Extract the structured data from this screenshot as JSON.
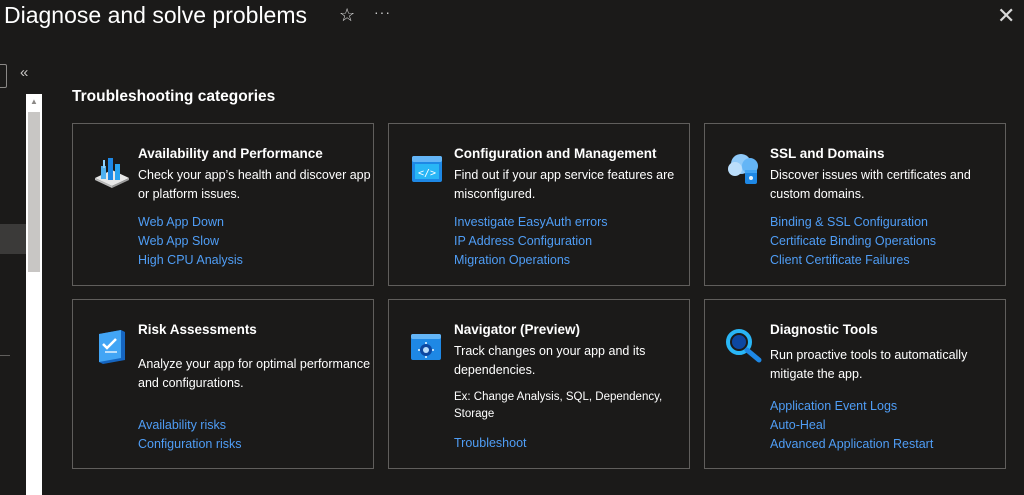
{
  "header": {
    "title": "Diagnose and solve problems",
    "favorite_icon": "☆",
    "more_icon": "···",
    "close_icon": "✕"
  },
  "sidebar": {
    "collapse_icon": "«"
  },
  "section": {
    "title": "Troubleshooting categories"
  },
  "cards": [
    {
      "icon": "availability-performance-icon",
      "title": "Availability and Performance",
      "description": "Check your app’s health and discover app or platform issues.",
      "links": [
        "Web App Down",
        "Web App Slow",
        "High CPU Analysis"
      ]
    },
    {
      "icon": "configuration-management-icon",
      "title": "Configuration and Management",
      "description": "Find out if your app service features are misconfigured.",
      "links": [
        "Investigate EasyAuth errors",
        "IP Address Configuration",
        "Migration Operations"
      ]
    },
    {
      "icon": "ssl-domains-icon",
      "title": "SSL and Domains",
      "description": "Discover issues with certificates and custom domains.",
      "links": [
        "Binding & SSL Configuration",
        "Certificate Binding Operations",
        "Client Certificate Failures"
      ]
    },
    {
      "icon": "risk-assessments-icon",
      "title": "Risk Assessments",
      "description": "Analyze your app for optimal performance and configurations.",
      "links": [
        "Availability risks",
        "Configuration risks"
      ]
    },
    {
      "icon": "navigator-icon",
      "title": "Navigator (Preview)",
      "description": "Track changes on your app and its dependencies.",
      "extra": "Ex: Change Analysis, SQL, Dependency, Storage",
      "links": [
        "Troubleshoot"
      ]
    },
    {
      "icon": "diagnostic-tools-icon",
      "title": "Diagnostic Tools",
      "description": "Run proactive tools to automatically mitigate the app.",
      "links": [
        "Application Event Logs",
        "Auto-Heal",
        "Advanced Application Restart"
      ]
    }
  ]
}
